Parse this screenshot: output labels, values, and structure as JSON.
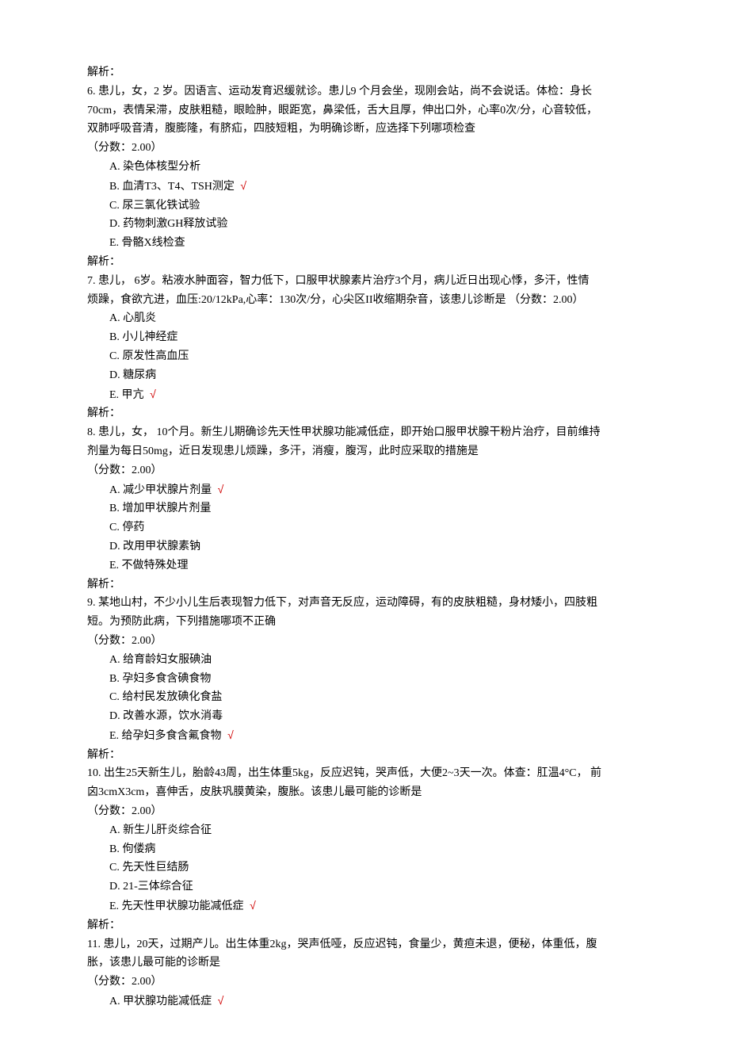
{
  "labels": {
    "jiexi": "解析：",
    "fenshu": "（分数：2.00）",
    "fenshu_inline": "（分数：2.00）"
  },
  "q6": {
    "stem1": "6. 患儿，女，2 岁。因语言、运动发育迟缓就诊。患儿9 个月会坐，现刚会站，尚不会说话。体检：身长",
    "stem2": "70cm，表情呆滞，皮肤粗糙，眼睑肿，眼距宽，鼻梁低，舌大且厚，伸出口外，心率0次/分，心音较低，",
    "stem3": "双肺呼吸音清，腹膨隆，有脐疝，四肢短粗，为明确诊断，应选择下列哪项检查",
    "a": "A. 染色体核型分析",
    "b": "B. 血清T3、T4、TSH测定",
    "b_mark": "√",
    "c": "C. 尿三氯化铁试验",
    "d": "D. 药物刺激GH释放试验",
    "e": "E. 骨骼X线检查"
  },
  "q7": {
    "stem1": "7. 患儿， 6岁。粘液水肿面容，智力低下，口服甲状腺素片治疗3个月，病儿近日出现心悸，多汗，性情",
    "stem2": "烦躁，食欲亢进，血压:20/12kPa,心率：130次/分，心尖区II收缩期杂音，该患儿诊断是 ",
    "a": "A. 心肌炎",
    "b": "B. 小儿神经症",
    "c": "C. 原发性高血压",
    "d": "D. 糖尿病",
    "e": "E. 甲亢",
    "e_mark": "√"
  },
  "q8": {
    "stem1": "8. 患儿，女， 10个月。新生儿期确诊先天性甲状腺功能减低症，即开始口服甲状腺干粉片治疗，目前维持",
    "stem2": "剂量为每日50mg，近日发现患儿烦躁，多汗，消瘦，腹泻，此时应采取的措施是",
    "a": "A. 减少甲状腺片剂量",
    "a_mark": "√",
    "b": "B. 增加甲状腺片剂量",
    "c": "C. 停药",
    "d": "D. 改用甲状腺素钠",
    "e": "E. 不做特殊处理"
  },
  "q9": {
    "stem1": "9. 某地山村，不少小儿生后表现智力低下，对声音无反应，运动障碍，有的皮肤粗糙，身材矮小，四肢粗",
    "stem2": "短。为预防此病，下列措施哪项不正确",
    "a": "A. 给育龄妇女服碘油",
    "b": "B. 孕妇多食含碘食物",
    "c": "C. 给村民发放碘化食盐",
    "d": "D. 改善水源，饮水消毒",
    "e": "E. 给孕妇多食含氟食物",
    "e_mark": "√"
  },
  "q10": {
    "stem1": "10. 出生25天新生儿，胎龄43周，出生体重5kg，反应迟钝，哭声低，大便2~3天一次。体查：肛温4°C， 前",
    "stem2": "囟3cmX3cm，喜伸舌，皮肤巩膜黄染，腹胀。该患儿最可能的诊断是",
    "a": "A. 新生儿肝炎综合征",
    "b": "B. 佝偻病",
    "c": "C. 先天性巨结肠",
    "d": "D. 21-三体综合征",
    "e": "E. 先天性甲状腺功能减低症",
    "e_mark": "√"
  },
  "q11": {
    "stem1": "11. 患儿，20天，过期产儿。出生体重2kg，哭声低哑，反应迟钝，食量少，黄疸未退，便秘，体重低，腹",
    "stem2": "胀，该患儿最可能的诊断是",
    "a": "A. 甲状腺功能减低症",
    "a_mark": "√"
  }
}
